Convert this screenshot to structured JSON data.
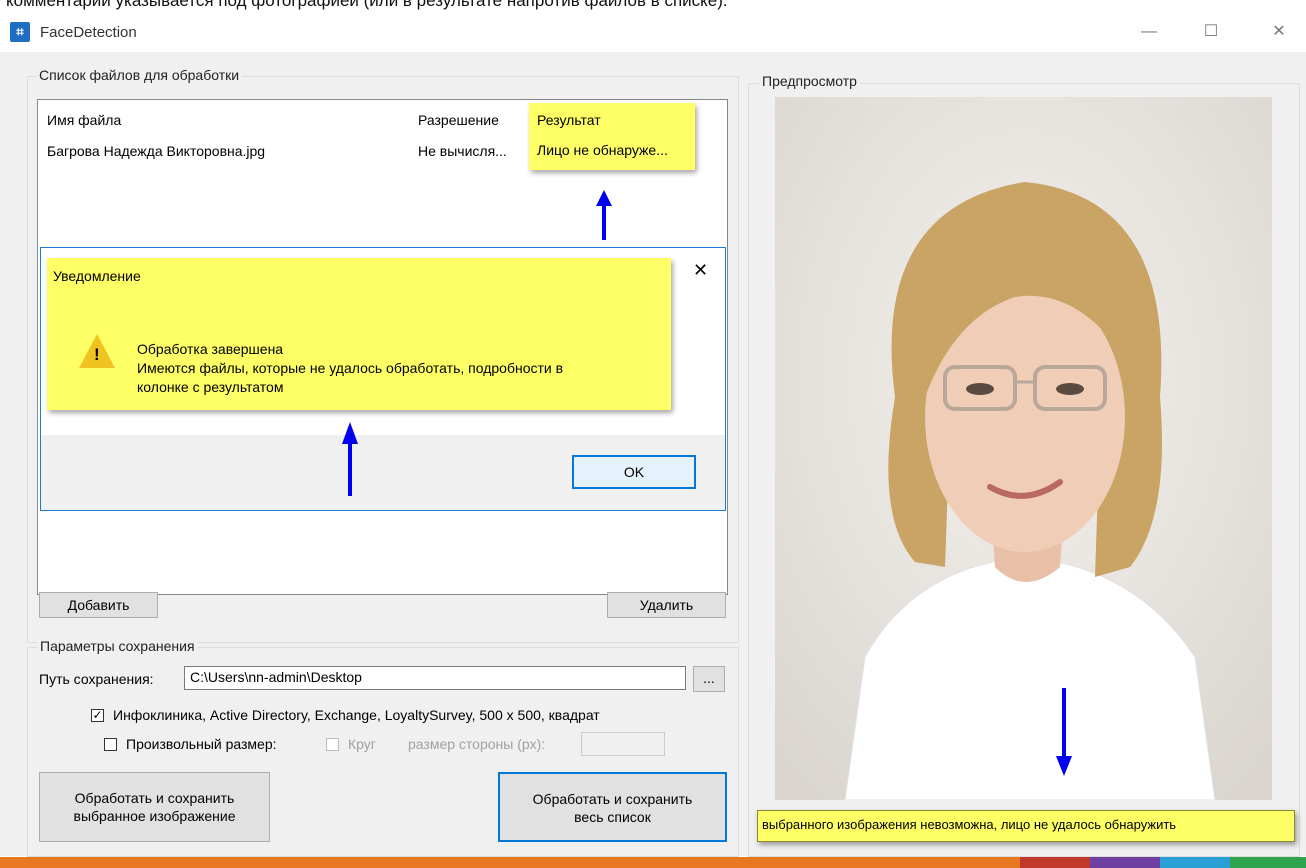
{
  "top_caption": "комментарий указывается под фотографией (или в результате напротив файлов в списке).",
  "window": {
    "title": "FaceDetection",
    "icon": "app-crop-icon"
  },
  "file_list": {
    "group_label": "Список файлов для обработки",
    "columns": [
      "Имя файла",
      "Разрешение",
      "Результат"
    ],
    "rows": [
      {
        "name": "Багрова Надежда Викторовна.jpg",
        "resolution": "Не вычисля...",
        "result": "Лицо не обнаруже..."
      }
    ],
    "add_label": "Добавить",
    "remove_label": "Удалить"
  },
  "dialog": {
    "title": "Уведомление",
    "line1": "Обработка завершена",
    "line2": "Имеются файлы, которые не удалось обработать, подробности в",
    "line3": "колонке с результатом",
    "ok_label": "OK",
    "icon": "warning-icon"
  },
  "save_params": {
    "group_label": "Параметры сохранения",
    "path_label": "Путь сохранения:",
    "path_value": "C:\\Users\\nn-admin\\Desktop",
    "browse_label": "...",
    "preset_label": "Инфоклиника, Active Directory, Exchange, LoyaltySurvey, 500 x 500, квадрат",
    "preset_checked": true,
    "custom_label": "Произвольный размер:",
    "custom_checked": false,
    "circle_label": "Круг",
    "side_label": "размер стороны (px):",
    "side_value": ""
  },
  "actions": {
    "process_selected_line1": "Обработать и сохранить",
    "process_selected_line2": "выбранное изображение",
    "process_all_line1": "Обработать и сохранить",
    "process_all_line2": "весь список"
  },
  "preview": {
    "group_label": "Предпросмотр",
    "status": "выбранного изображения невозможна, лицо не удалось обнаружить"
  },
  "colors": {
    "highlight": "#ffff66",
    "arrow": "#0000ee",
    "accent": "#0078d7"
  }
}
